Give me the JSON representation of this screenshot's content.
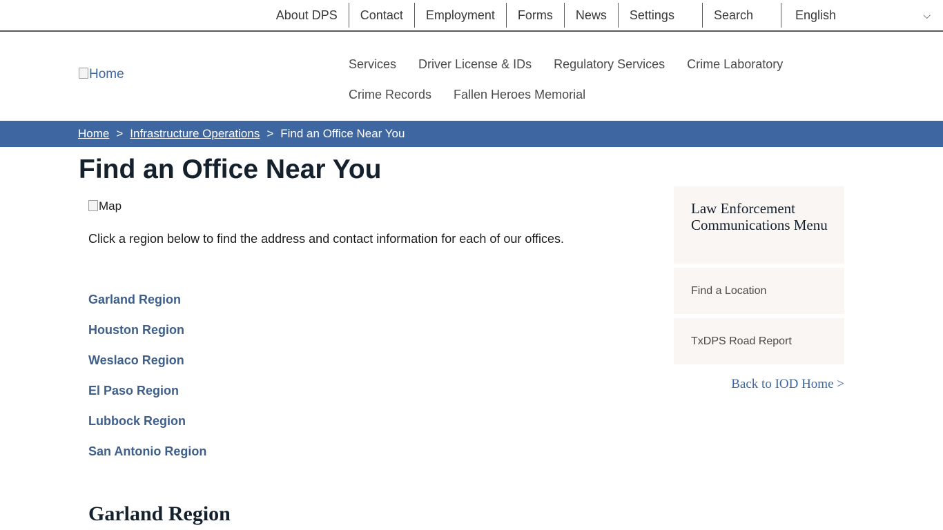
{
  "utility_nav": {
    "items": [
      "About DPS",
      "Contact",
      "Employment",
      "Forms",
      "News",
      "Settings"
    ],
    "search_label": "Search",
    "language_selected": "English"
  },
  "header": {
    "logo_alt": "Home",
    "nav_items": [
      "Services",
      "Driver License & IDs",
      "Regulatory Services",
      "Crime Laboratory",
      "Crime Records",
      "Fallen Heroes Memorial"
    ]
  },
  "breadcrumb": {
    "home": "Home",
    "separator": ">",
    "parent": "Infrastructure Operations",
    "current": "Find an Office Near You"
  },
  "main": {
    "title": "Find an Office Near You",
    "map_alt": "Map",
    "intro": "Click a region below to find the address and contact information for each of our offices.",
    "regions": [
      "Garland Region",
      "Houston Region",
      "Weslaco Region",
      "El Paso Region",
      "Lubbock Region",
      "San Antonio Region"
    ],
    "section_heading": "Garland Region"
  },
  "sidebar": {
    "heading": "Law Enforcement Communications Menu",
    "items": [
      "Find a Location",
      "TxDPS Road Report"
    ],
    "back_link": "Back to IOD Home >"
  },
  "colors": {
    "brand_blue": "#3e67a1",
    "link_blue": "#3e5f8a",
    "sidebar_bg": "#faf6f3",
    "title_text": "#14202c"
  }
}
